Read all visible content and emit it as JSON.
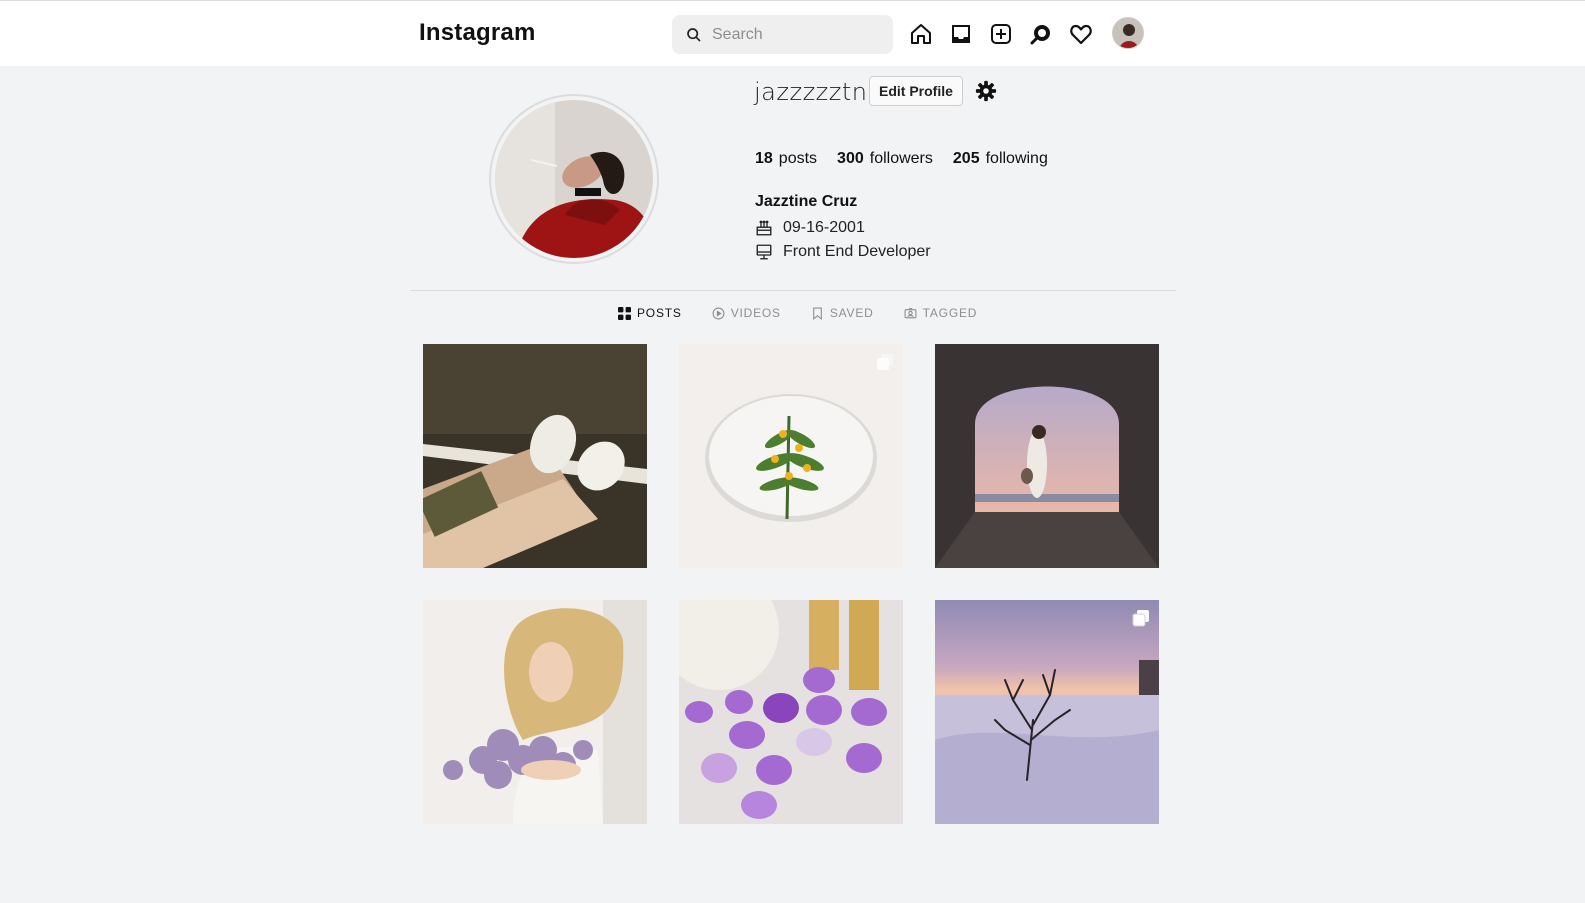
{
  "header": {
    "brand": "Instagram",
    "search_placeholder": "Search",
    "icons": [
      "home-icon",
      "inbox-icon",
      "new-post-icon",
      "explore-icon",
      "activity-heart-icon",
      "profile-avatar"
    ]
  },
  "profile": {
    "username": "jazzzzztn",
    "edit_label": "Edit Profile",
    "stats": [
      {
        "count": "18",
        "label": "posts"
      },
      {
        "count": "300",
        "label": "followers"
      },
      {
        "count": "205",
        "label": "following"
      }
    ],
    "full_name": "Jazztine Cruz",
    "birthday": "09-16-2001",
    "occupation": "Front End Developer"
  },
  "tabs": [
    {
      "label": "POSTS",
      "icon": "grid-icon",
      "active": true
    },
    {
      "label": "VIDEOS",
      "icon": "play-icon",
      "active": false
    },
    {
      "label": "SAVED",
      "icon": "bookmark-icon",
      "active": false
    },
    {
      "label": "TAGGED",
      "icon": "tagged-icon",
      "active": false
    }
  ],
  "posts": [
    {
      "subject": "sneakers on asphalt",
      "multiple": false
    },
    {
      "subject": "herb on white plate",
      "multiple": true
    },
    {
      "subject": "woman in archway at sunset",
      "multiple": false
    },
    {
      "subject": "woman with lilac bouquet",
      "multiple": false
    },
    {
      "subject": "purple easter eggs",
      "multiple": false
    },
    {
      "subject": "bare tree in snow",
      "multiple": true
    }
  ],
  "colors": {
    "background": "#f2f3f5",
    "text": "#111111",
    "muted": "#8e8e8e"
  }
}
